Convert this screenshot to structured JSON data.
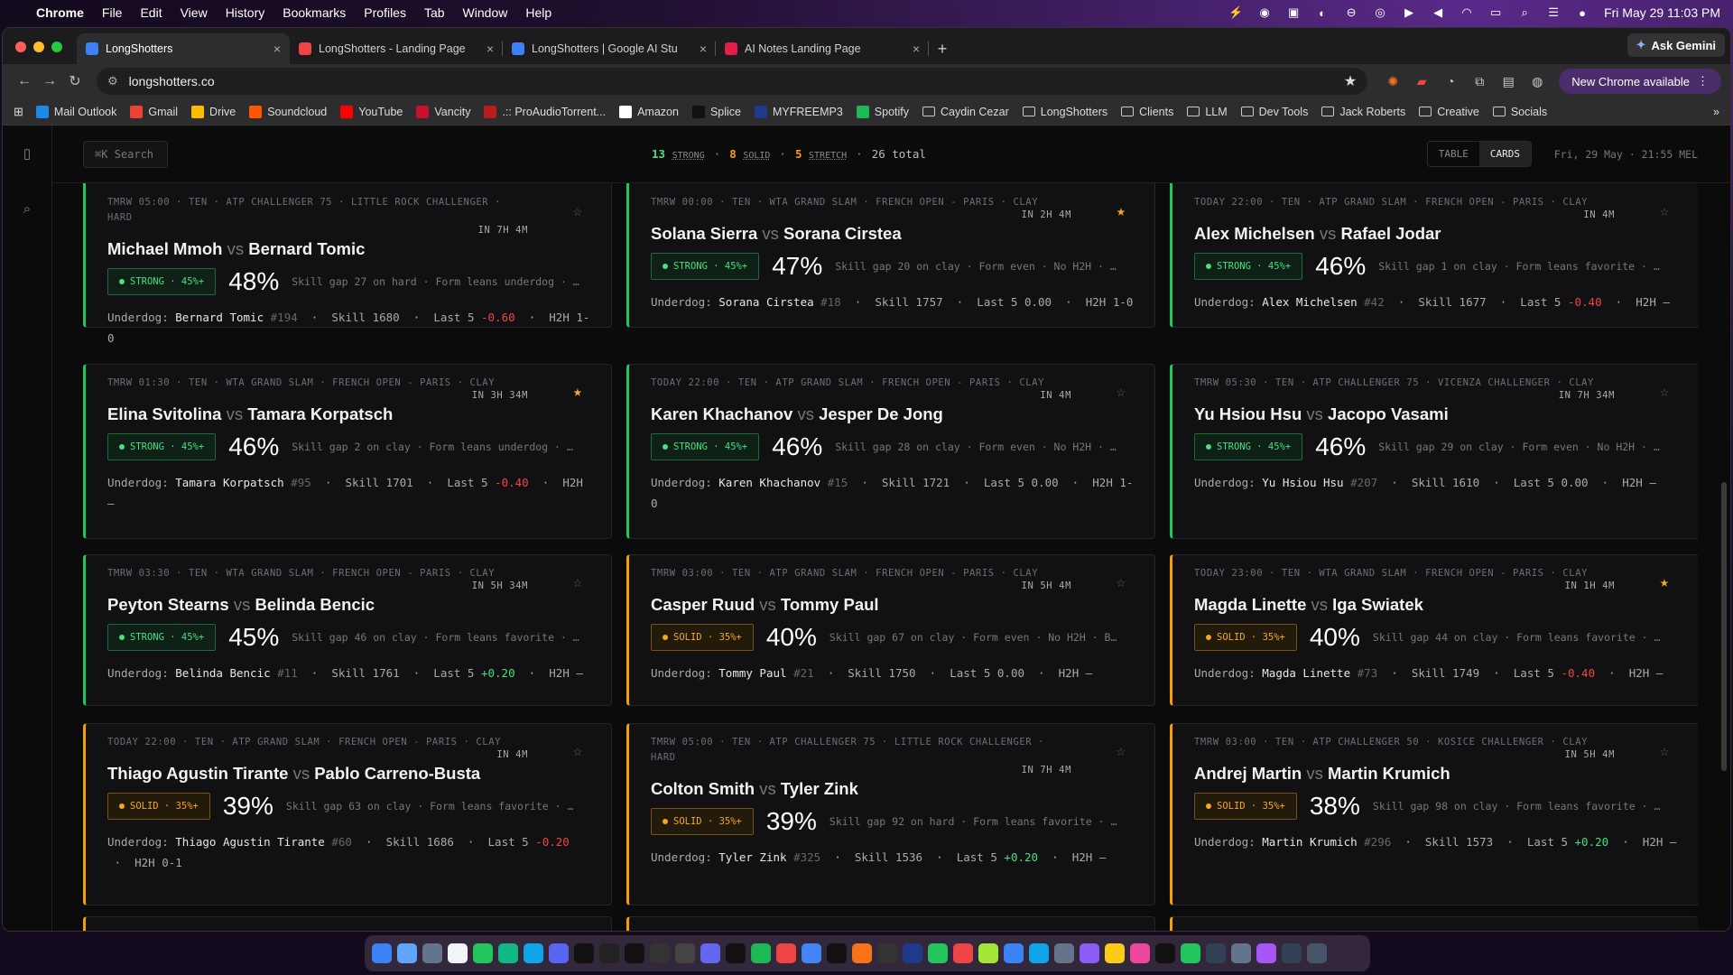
{
  "menubar": {
    "app": "Chrome",
    "items": [
      "File",
      "Edit",
      "View",
      "History",
      "Bookmarks",
      "Profiles",
      "Tab",
      "Window",
      "Help"
    ],
    "datetime": "Fri May 29  11:03 PM"
  },
  "tabs": [
    {
      "title": "LongShotters",
      "active": true,
      "color": "#3b82f6"
    },
    {
      "title": "LongShotters - Landing Page",
      "active": false,
      "color": "#ef4444"
    },
    {
      "title": "LongShotters | Google AI Stu",
      "active": false,
      "color": "#3b82f6"
    },
    {
      "title": "AI Notes Landing Page",
      "active": false,
      "color": "#e11d48"
    }
  ],
  "gemini": "Ask Gemini",
  "url": "longshotters.co",
  "new_chrome": "New Chrome available",
  "bookmarks": [
    {
      "label": "Mail Outlook",
      "icon": "#1e88e5"
    },
    {
      "label": "Gmail",
      "icon": "#ea4335"
    },
    {
      "label": "Drive",
      "icon": "#fbbc04"
    },
    {
      "label": "Soundcloud",
      "icon": "#ff5500"
    },
    {
      "label": "YouTube",
      "icon": "#ff0000"
    },
    {
      "label": "Vancity",
      "icon": "#c8102e"
    },
    {
      "label": ".:: ProAudioTorrent...",
      "icon": "#b91c1c"
    },
    {
      "label": "Amazon",
      "icon": "#ffffff"
    },
    {
      "label": "Splice",
      "icon": "#111111"
    },
    {
      "label": "MYFREEMP3",
      "icon": "#1e3a8a"
    },
    {
      "label": "Spotify",
      "icon": "#1db954"
    },
    {
      "label": "Caydin Cezar",
      "folder": true
    },
    {
      "label": "LongShotters",
      "folder": true
    },
    {
      "label": "Clients",
      "folder": true
    },
    {
      "label": "LLM",
      "folder": true
    },
    {
      "label": "Dev Tools",
      "folder": true
    },
    {
      "label": "Jack Roberts",
      "folder": true
    },
    {
      "label": "Creative",
      "folder": true
    },
    {
      "label": "Socials",
      "folder": true
    }
  ],
  "search": {
    "placeholder": "⌘K Search"
  },
  "counts": {
    "strong_n": "13",
    "strong": "STRONG",
    "solid_n": "8",
    "solid": "SOLID",
    "stretch_n": "5",
    "stretch": "STRETCH",
    "total": "26 total"
  },
  "view": {
    "table": "TABLE",
    "cards": "CARDS"
  },
  "clock": "Fri, 29 May · 21:55 MEL",
  "cards": [
    {
      "meta": "TMRW 05:00 · TEN · ATP CHALLENGER 75 · LITTLE ROCK CHALLENGER · HARD",
      "when": "IN 7H 4M",
      "p1": "Michael Mmoh",
      "p2": "Bernard Tomic",
      "tier": "strong",
      "badge": "STRONG · 45%+",
      "pct": "48%",
      "why": "Skill gap 27 on hard · Form leans underdog · …",
      "dog": "Bernard Tomic",
      "rank": "#194",
      "skill": "1680",
      "last5": "-0.60",
      "h2h": "1-0",
      "fav": false
    },
    {
      "meta": "TMRW 00:00 · TEN · WTA GRAND SLAM · FRENCH OPEN - PARIS · CLAY",
      "when": "IN 2H 4M",
      "p1": "Solana Sierra",
      "p2": "Sorana Cirstea",
      "tier": "strong",
      "badge": "STRONG · 45%+",
      "pct": "47%",
      "why": "Skill gap 20 on clay · Form even · No H2H · …",
      "dog": "Sorana Cirstea",
      "rank": "#18",
      "skill": "1757",
      "last5": "0.00",
      "h2h": "1-0",
      "fav": true
    },
    {
      "meta": "TODAY 22:00 · TEN · ATP GRAND SLAM · FRENCH OPEN - PARIS · CLAY",
      "when": "IN 4M",
      "p1": "Alex Michelsen",
      "p2": "Rafael Jodar",
      "tier": "strong",
      "badge": "STRONG · 45%+",
      "pct": "46%",
      "why": "Skill gap 1 on clay · Form leans favorite · …",
      "dog": "Alex Michelsen",
      "rank": "#42",
      "skill": "1677",
      "last5": "-0.40",
      "h2h": "—",
      "fav": false
    },
    {
      "meta": "TMRW 01:30 · TEN · WTA GRAND SLAM · FRENCH OPEN - PARIS · CLAY",
      "when": "IN 3H 34M",
      "p1": "Elina Svitolina",
      "p2": "Tamara Korpatsch",
      "tier": "strong",
      "badge": "STRONG · 45%+",
      "pct": "46%",
      "why": "Skill gap 2 on clay · Form leans underdog · …",
      "dog": "Tamara Korpatsch",
      "rank": "#95",
      "skill": "1701",
      "last5": "-0.40",
      "h2h": "—",
      "fav": true
    },
    {
      "meta": "TODAY 22:00 · TEN · ATP GRAND SLAM · FRENCH OPEN - PARIS · CLAY",
      "when": "IN 4M",
      "p1": "Karen Khachanov",
      "p2": "Jesper De Jong",
      "tier": "strong",
      "badge": "STRONG · 45%+",
      "pct": "46%",
      "why": "Skill gap 28 on clay · Form even · No H2H · …",
      "dog": "Karen Khachanov",
      "rank": "#15",
      "skill": "1721",
      "last5": "0.00",
      "h2h": "1-0",
      "fav": false
    },
    {
      "meta": "TMRW 05:30 · TEN · ATP CHALLENGER 75 · VICENZA CHALLENGER · CLAY",
      "when": "IN 7H 34M",
      "p1": "Yu Hsiou Hsu",
      "p2": "Jacopo Vasami",
      "tier": "strong",
      "badge": "STRONG · 45%+",
      "pct": "46%",
      "why": "Skill gap 29 on clay · Form even · No H2H · …",
      "dog": "Yu Hsiou Hsu",
      "rank": "#207",
      "skill": "1610",
      "last5": "0.00",
      "h2h": "—",
      "fav": false
    },
    {
      "meta": "TMRW 03:30 · TEN · WTA GRAND SLAM · FRENCH OPEN - PARIS · CLAY",
      "when": "IN 5H 34M",
      "p1": "Peyton Stearns",
      "p2": "Belinda Bencic",
      "tier": "strong",
      "badge": "STRONG · 45%+",
      "pct": "45%",
      "why": "Skill gap 46 on clay · Form leans favorite · …",
      "dog": "Belinda Bencic",
      "rank": "#11",
      "skill": "1761",
      "last5": "+0.20",
      "h2h": "—",
      "fav": false
    },
    {
      "meta": "TMRW 03:00 · TEN · ATP GRAND SLAM · FRENCH OPEN - PARIS · CLAY",
      "when": "IN 5H 4M",
      "p1": "Casper Ruud",
      "p2": "Tommy Paul",
      "tier": "solid",
      "badge": "SOLID · 35%+",
      "pct": "40%",
      "why": "Skill gap 67 on clay · Form even · No H2H · B…",
      "dog": "Tommy Paul",
      "rank": "#21",
      "skill": "1750",
      "last5": "0.00",
      "h2h": "—",
      "fav": false
    },
    {
      "meta": "TODAY 23:00 · TEN · WTA GRAND SLAM · FRENCH OPEN - PARIS · CLAY",
      "when": "IN 1H 4M",
      "p1": "Magda Linette",
      "p2": "Iga Swiatek",
      "tier": "solid",
      "badge": "SOLID · 35%+",
      "pct": "40%",
      "why": "Skill gap 44 on clay · Form leans favorite · …",
      "dog": "Magda Linette",
      "rank": "#73",
      "skill": "1749",
      "last5": "-0.40",
      "h2h": "—",
      "fav": true
    },
    {
      "meta": "TODAY 22:00 · TEN · ATP GRAND SLAM · FRENCH OPEN - PARIS · CLAY",
      "when": "IN 4M",
      "p1": "Thiago Agustin Tirante",
      "p2": "Pablo Carreno-Busta",
      "tier": "solid",
      "badge": "SOLID · 35%+",
      "pct": "39%",
      "why": "Skill gap 63 on clay · Form leans favorite · …",
      "dog": "Thiago Agustin Tirante",
      "rank": "#60",
      "skill": "1686",
      "last5": "-0.20",
      "h2h": "0-1",
      "fav": false
    },
    {
      "meta": "TMRW 05:00 · TEN · ATP CHALLENGER 75 · LITTLE ROCK CHALLENGER · HARD",
      "when": "IN 7H 4M",
      "p1": "Colton Smith",
      "p2": "Tyler Zink",
      "tier": "solid",
      "badge": "SOLID · 35%+",
      "pct": "39%",
      "why": "Skill gap 92 on hard · Form leans favorite · …",
      "dog": "Tyler Zink",
      "rank": "#325",
      "skill": "1536",
      "last5": "+0.20",
      "h2h": "—",
      "fav": false
    },
    {
      "meta": "TMRW 03:00 · TEN · ATP CHALLENGER 50 · KOSICE CHALLENGER · CLAY",
      "when": "IN 5H 4M",
      "p1": "Andrej Martin",
      "p2": "Martin Krumich",
      "tier": "solid",
      "badge": "SOLID · 35%+",
      "pct": "38%",
      "why": "Skill gap 98 on clay · Form leans favorite · …",
      "dog": "Martin Krumich",
      "rank": "#296",
      "skill": "1573",
      "last5": "+0.20",
      "h2h": "—",
      "fav": false
    }
  ],
  "labels": {
    "underdog": "Underdog:",
    "skill": "Skill",
    "last5": "Last 5",
    "h2h": "H2H",
    "vs": "vs"
  },
  "colors": {
    "strong": "#22c55e",
    "solid": "#f59e0b",
    "star_on": "#f5a623"
  }
}
